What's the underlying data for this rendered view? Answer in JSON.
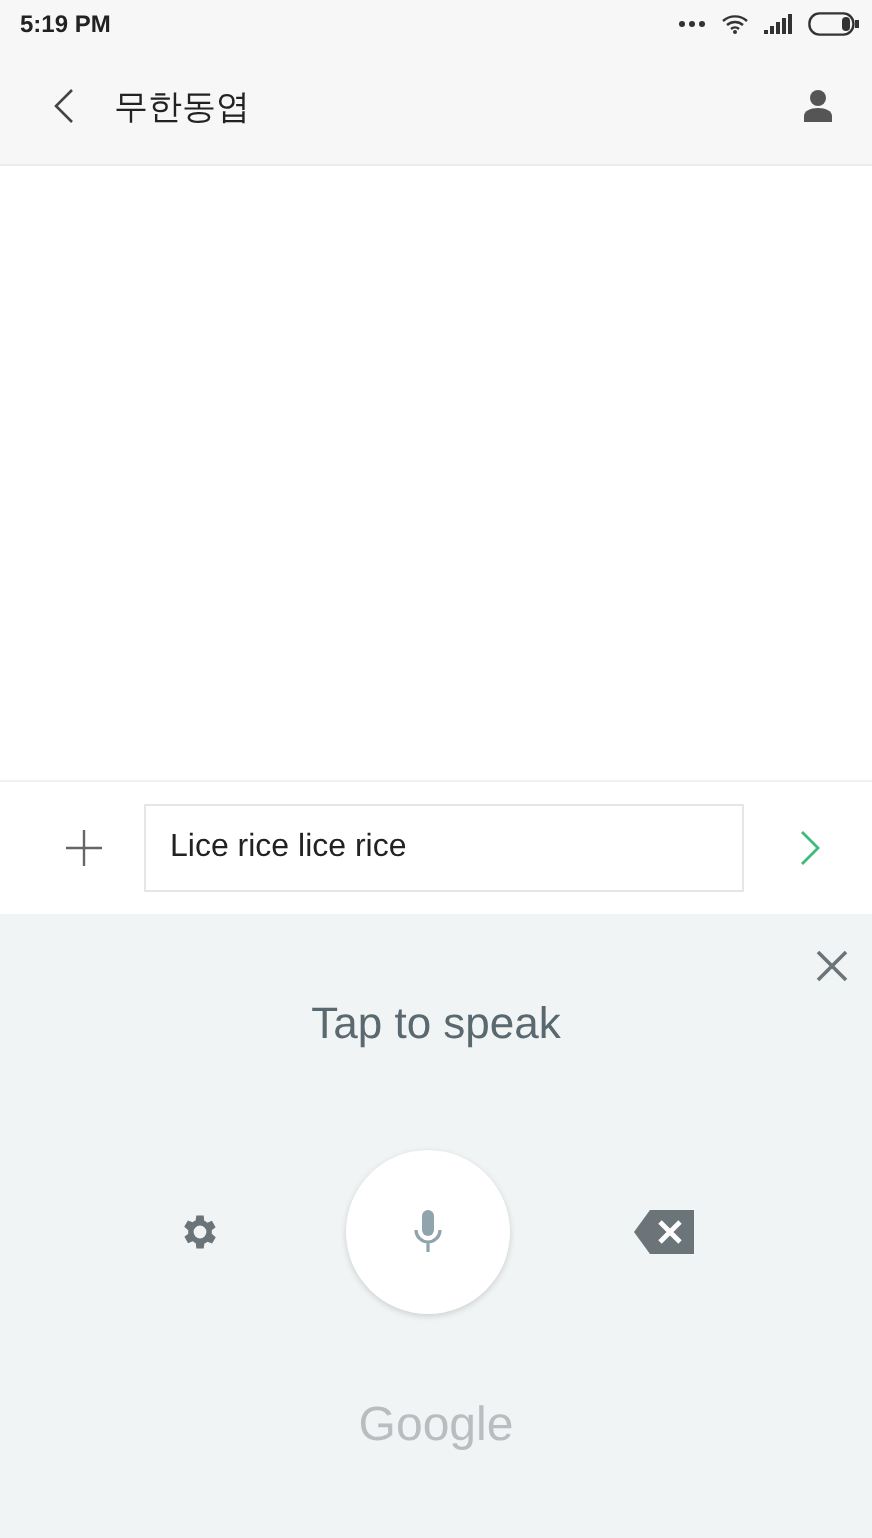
{
  "status_bar": {
    "time": "5:19 PM"
  },
  "header": {
    "title": "무한동엽"
  },
  "composer": {
    "value": "Lice rice lice rice"
  },
  "voice_panel": {
    "prompt": "Tap to speak",
    "brand": "Google"
  }
}
